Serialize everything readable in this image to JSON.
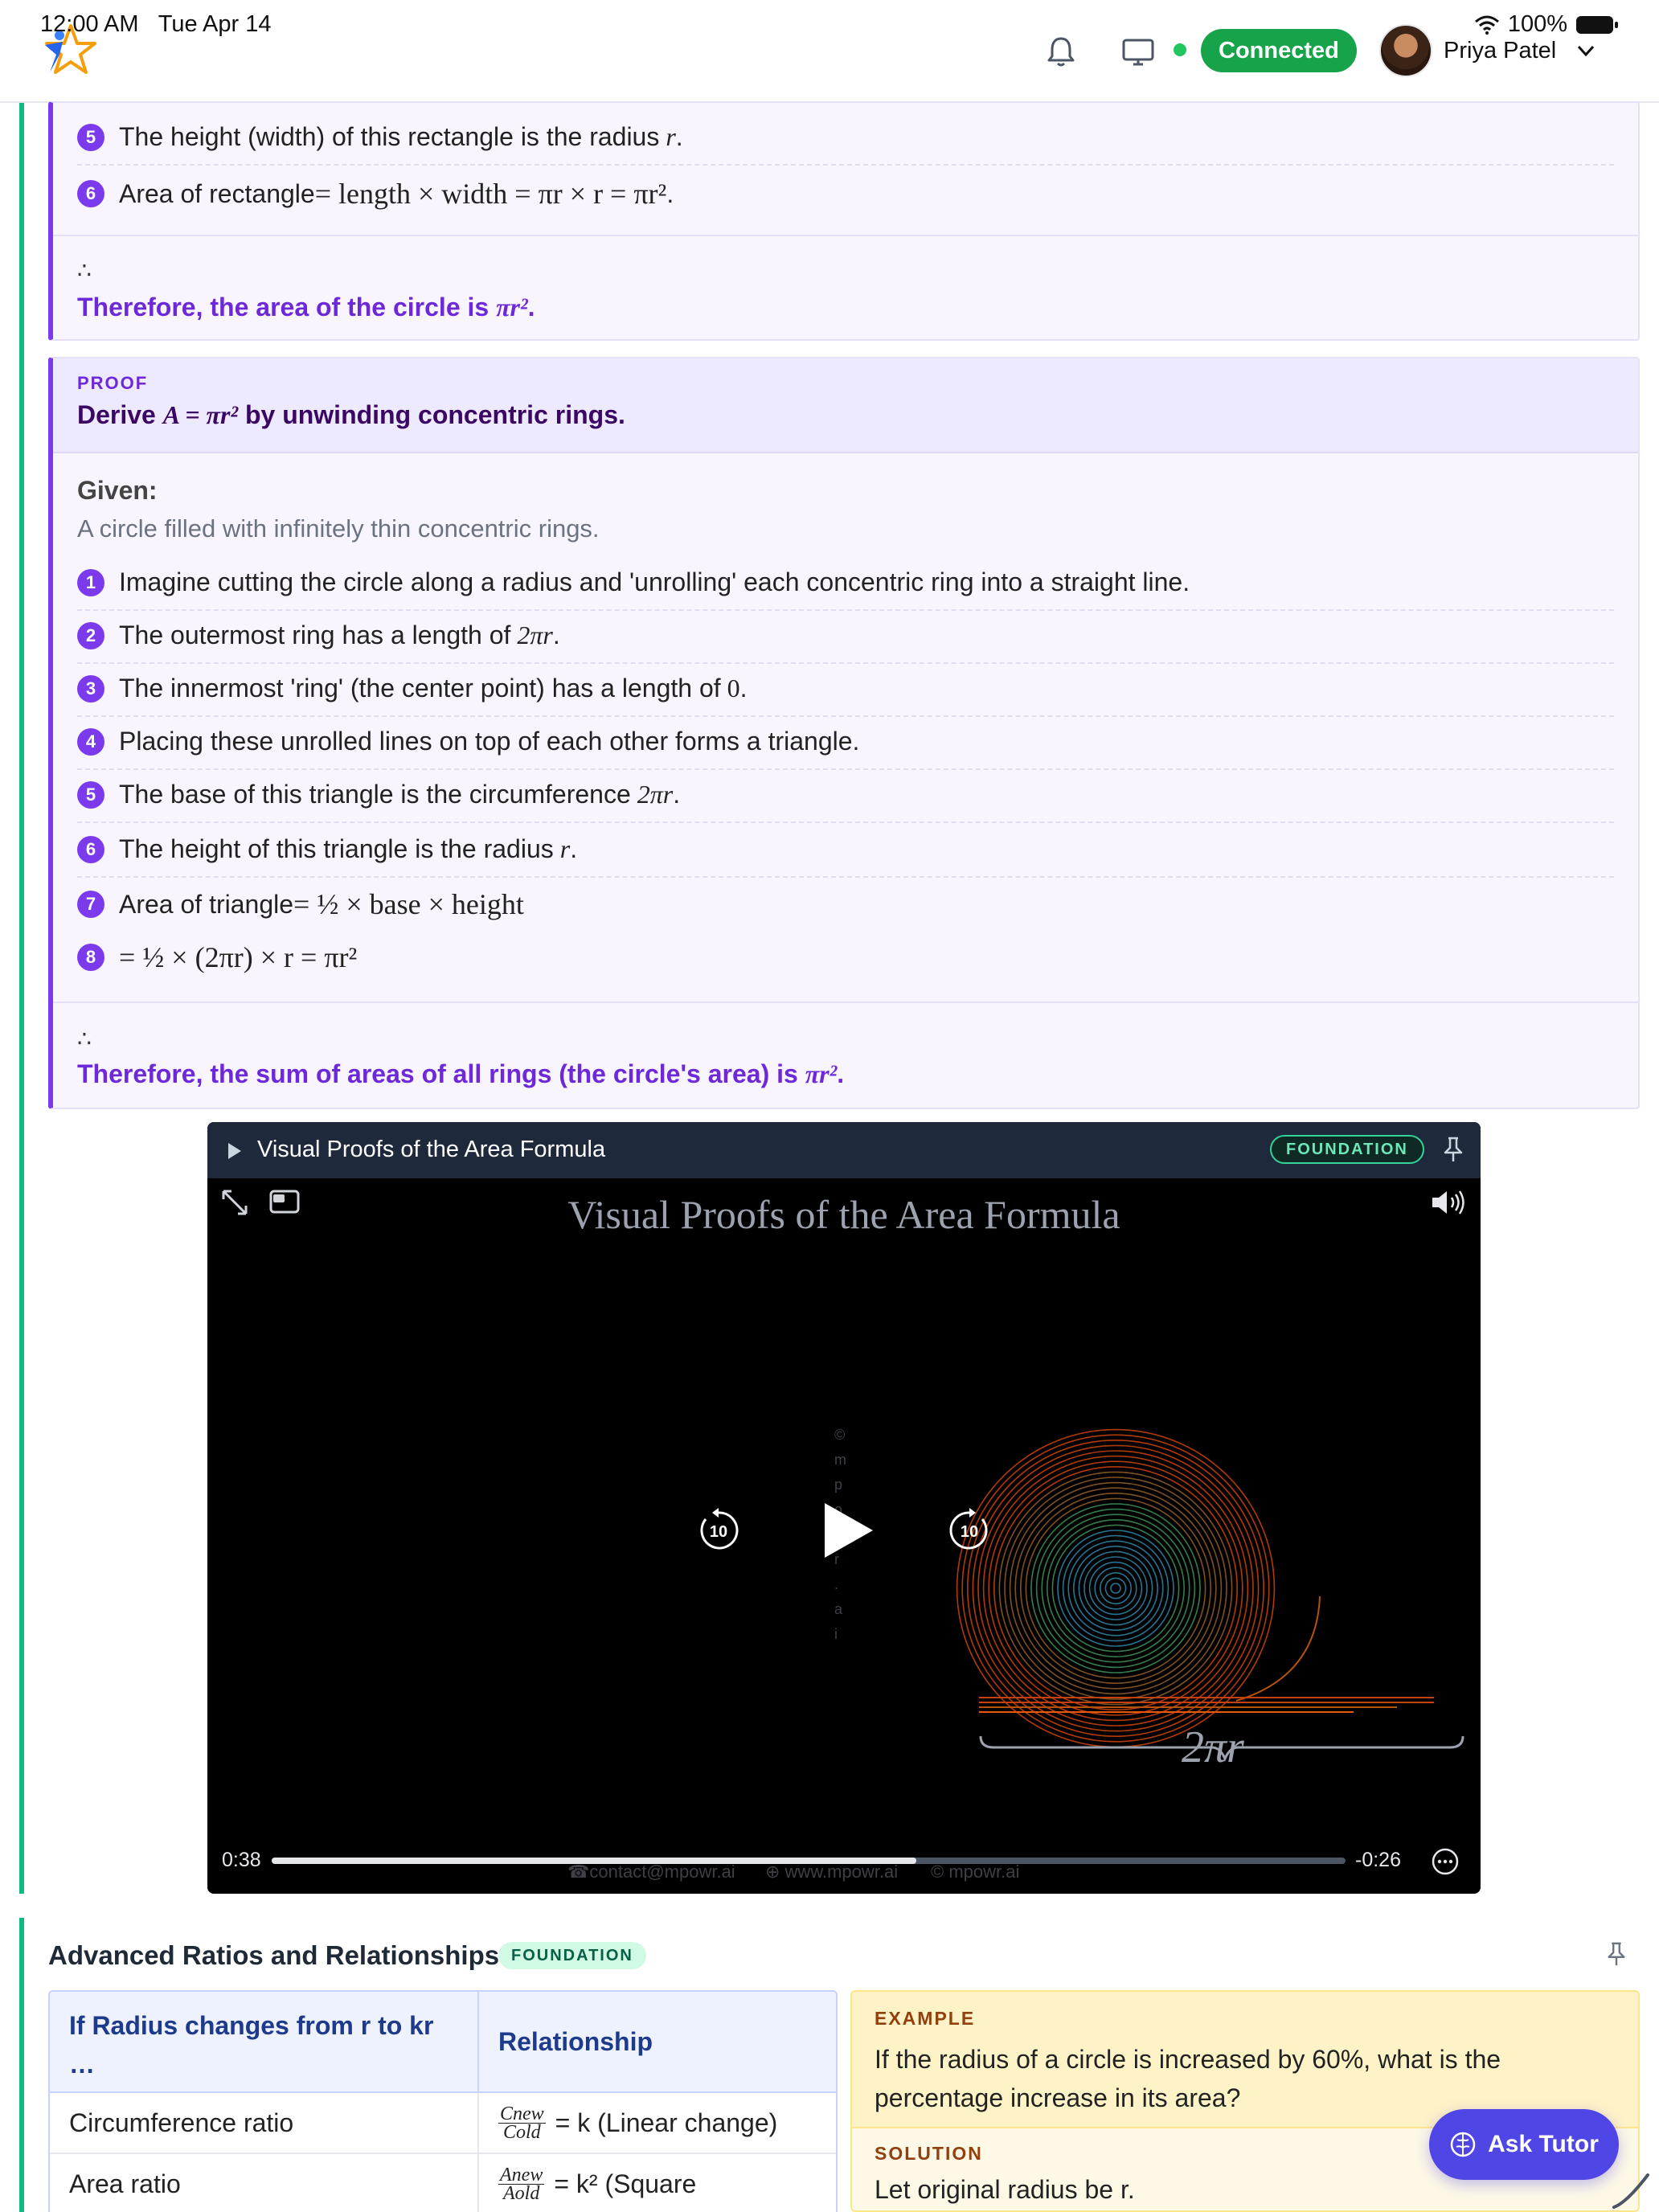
{
  "status_bar": {
    "time": "12:00 AM",
    "date": "Tue Apr 14",
    "battery": "100%"
  },
  "header": {
    "connection_label": "Connected",
    "user_name": "Priya Patel"
  },
  "proof1": {
    "steps": [
      {
        "n": "5",
        "text": "The height (width) of this rectangle is the radius ",
        "math": "r",
        "tail": "."
      },
      {
        "n": "6",
        "text": "Area of rectangle ",
        "math": "= length × width = πr × r = πr²",
        "tail": "."
      }
    ],
    "therefore_symbol": "∴",
    "conclusion": "Therefore, the area of the circle is ",
    "conclusion_math": "πr²",
    "conclusion_tail": "."
  },
  "proof2": {
    "label": "PROOF",
    "title_prefix": "Derive ",
    "title_math": "A = πr²",
    "title_suffix": " by unwinding concentric rings.",
    "given_label": "Given:",
    "given_text": "A circle filled with infinitely thin concentric rings.",
    "steps": [
      {
        "n": "1",
        "text": "Imagine cutting the circle along a radius and 'unrolling' each concentric ring into a straight line.",
        "math": "",
        "tail": ""
      },
      {
        "n": "2",
        "text": "The outermost ring has a length of ",
        "math": "2πr",
        "tail": "."
      },
      {
        "n": "3",
        "text": "The innermost 'ring' (the center point) has a length of ",
        "math": "0",
        "tail": "."
      },
      {
        "n": "4",
        "text": "Placing these unrolled lines on top of each other forms a triangle.",
        "math": "",
        "tail": ""
      },
      {
        "n": "5",
        "text": "The base of this triangle is the circumference ",
        "math": "2πr",
        "tail": "."
      },
      {
        "n": "6",
        "text": "The height of this triangle is the radius ",
        "math": "r",
        "tail": "."
      },
      {
        "n": "7",
        "text": "Area of triangle ",
        "math": "= ½ × base × height",
        "tail": ""
      },
      {
        "n": "8",
        "text": "",
        "math": "= ½ × (2πr) × r = πr²",
        "tail": ""
      }
    ],
    "therefore_symbol": "∴",
    "conclusion": "Therefore, the sum of areas of all rings (the circle's area) is ",
    "conclusion_math": "πr²",
    "conclusion_tail": "."
  },
  "video": {
    "title": "Visual Proofs of the Area Formula",
    "badge": "FOUNDATION",
    "overlay_title": "Visual Proofs of the Area Formula",
    "label_2pr": "2πr",
    "time_elapsed": "0:38",
    "time_remaining": "-0:26",
    "progress": 0.6,
    "watermarks": [
      "☎contact@mpowr.ai",
      "⊕ www.mpowr.ai",
      "© mpowr.ai"
    ],
    "vertical_watermark": "© m p o w r . a i",
    "skip_back": "10",
    "skip_forward": "10"
  },
  "ratios": {
    "title": "Advanced Ratios and Relationships",
    "badge": "FOUNDATION",
    "table": {
      "header_col1": "If Radius changes from r to kr …",
      "header_col2": "Relationship",
      "rows": [
        {
          "label": "Circumference ratio",
          "frac_num": "Cnew",
          "frac_den": "Cold",
          "rel": "= k (Linear change)"
        },
        {
          "label": "Area ratio",
          "frac_num": "Anew",
          "frac_den": "Aold",
          "rel": "= k² (Square"
        }
      ]
    },
    "example": {
      "label": "EXAMPLE",
      "question": "If the radius of a circle is increased by 60%, what is the percentage increase in its area?",
      "solution_label": "SOLUTION",
      "solution_text": "Let original radius be r."
    }
  },
  "ask_tutor": {
    "label": "Ask Tutor"
  },
  "colors": {
    "accent_green": "#10b981",
    "proof_purple": "#7c3aed",
    "tutor_indigo": "#4f46e5"
  }
}
